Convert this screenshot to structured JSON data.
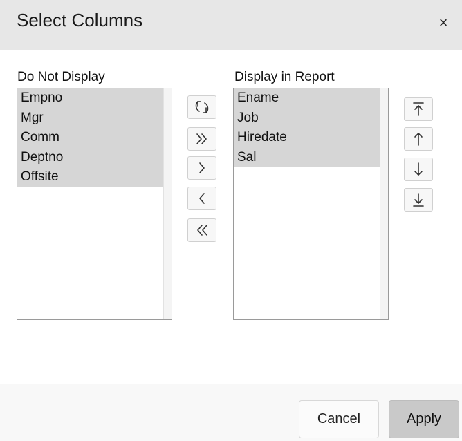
{
  "dialog": {
    "title": "Select Columns",
    "close_label": "×"
  },
  "lists": {
    "available": {
      "label": "Do Not Display",
      "items": [
        "Empno",
        "Mgr",
        "Comm",
        "Deptno",
        "Offsite"
      ]
    },
    "selected": {
      "label": "Display in Report",
      "items": [
        "Ename",
        "Job",
        "Hiredate",
        "Sal"
      ]
    }
  },
  "transfer_buttons": [
    {
      "name": "reset-button",
      "icon": "reset-icon"
    },
    {
      "name": "move-all-button",
      "icon": "double-chevron-right-icon"
    },
    {
      "name": "move-button",
      "icon": "chevron-right-icon"
    },
    {
      "name": "remove-button",
      "icon": "chevron-left-icon"
    },
    {
      "name": "remove-all-button",
      "icon": "double-chevron-left-icon"
    }
  ],
  "order_buttons": [
    {
      "name": "move-top-button",
      "icon": "arrow-top-icon"
    },
    {
      "name": "move-up-button",
      "icon": "arrow-up-icon"
    },
    {
      "name": "move-down-button",
      "icon": "arrow-down-icon"
    },
    {
      "name": "move-bottom-button",
      "icon": "arrow-bottom-icon"
    }
  ],
  "footer": {
    "cancel_label": "Cancel",
    "apply_label": "Apply"
  },
  "colors": {
    "titlebar": "#e7e7e7",
    "selected_item": "#d6d6d6",
    "apply_button": "#c9c9c9"
  }
}
